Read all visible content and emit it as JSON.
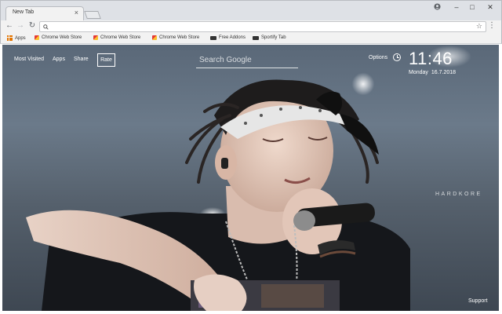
{
  "browser": {
    "tab_title": "New Tab",
    "tab_close": "×",
    "window_controls": {
      "minimize": "–",
      "maximize": "□",
      "close": "✕"
    },
    "address_value": "",
    "bookmarks": [
      {
        "label": "Apps",
        "icon": "apps-grid-icon"
      },
      {
        "label": "Chrome Web Store",
        "icon": "chrome-web-store-icon"
      },
      {
        "label": "Chrome Web Store",
        "icon": "chrome-web-store-icon"
      },
      {
        "label": "Chrome Web Store",
        "icon": "chrome-web-store-icon"
      },
      {
        "label": "Free Addons",
        "icon": "free-addons-icon"
      },
      {
        "label": "Sportify Tab",
        "icon": "sportify-tab-icon"
      }
    ]
  },
  "newtab": {
    "nav": {
      "most_visited": "Most Visited",
      "apps": "Apps",
      "share": "Share",
      "rate": "Rate"
    },
    "search_placeholder": "Search Google",
    "options": "Options",
    "time": "11:46",
    "day": "Monday",
    "date": "16.7.2018",
    "watermark": "HARDKORE",
    "support": "Support"
  },
  "colors": {
    "accent_orange": "#e37400",
    "chrome_bg": "#dee1e6",
    "toolbar_bg": "#f2f2f2"
  }
}
